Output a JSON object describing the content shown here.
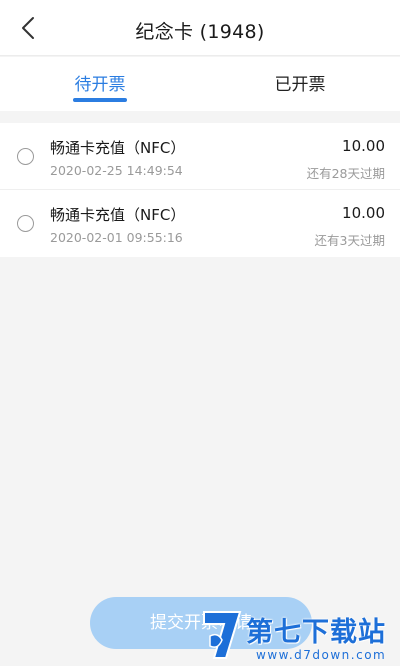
{
  "header": {
    "title": "纪念卡 (1948)",
    "back_icon": "chevron-left-icon"
  },
  "tabs": [
    {
      "label": "待开票",
      "active": true
    },
    {
      "label": "已开票",
      "active": false
    }
  ],
  "records": [
    {
      "name": "畅通卡充值（NFC）",
      "time": "2020-02-25 14:49:54",
      "amount": "10.00",
      "expiry": "还有28天过期",
      "selected": false
    },
    {
      "name": "畅通卡充值（NFC）",
      "time": "2020-02-01 09:55:16",
      "amount": "10.00",
      "expiry": "还有3天过期",
      "selected": false
    }
  ],
  "submit": {
    "label": "提交开票申请",
    "enabled": false
  },
  "watermark": {
    "name": "第七下载站",
    "url": "www.d7down.com"
  },
  "colors": {
    "accent": "#2b7de1",
    "button_disabled": "#a8d0f5",
    "watermark": "#1d6fd8"
  }
}
